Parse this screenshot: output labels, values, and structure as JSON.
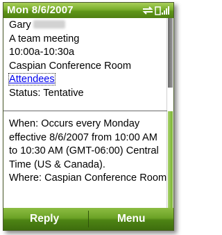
{
  "titlebar": {
    "date": "Mon 8/6/2007",
    "icons": [
      "sync-icon",
      "signal-strength-icon"
    ]
  },
  "appointment": {
    "organizer_first_name": "Gary",
    "subject": "A team meeting",
    "time": "10:00a-10:30a",
    "location": "Caspian Conference Room",
    "attendees_link": "Attendees",
    "status": "Status: Tentative"
  },
  "recurrence": {
    "lines": [
      "When: Occurs every Monday",
      "effective 8/6/2007 from 10:00 AM",
      "to 10:30 AM (GMT-06:00) Central",
      "Time (US & Canada).",
      "Where: Caspian Conference Room"
    ]
  },
  "softkeys": {
    "left": "Reply",
    "right": "Menu"
  },
  "colors": {
    "accent_green": "#6ca226",
    "link_blue": "#0000ee"
  }
}
